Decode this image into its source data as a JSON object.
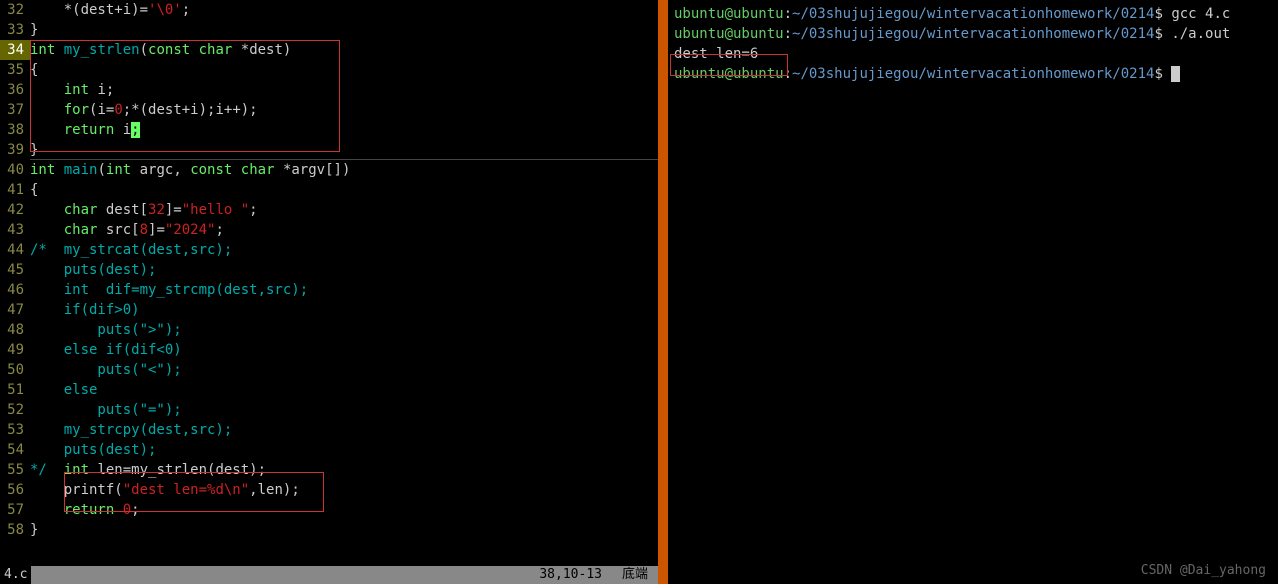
{
  "editor": {
    "lines": [
      {
        "num": "32",
        "tokens": [
          {
            "t": "    ",
            "c": ""
          },
          {
            "t": "*(dest+i)=",
            "c": "op"
          },
          {
            "t": "'\\0'",
            "c": "str"
          },
          {
            "t": ";",
            "c": "op"
          }
        ]
      },
      {
        "num": "33",
        "tokens": [
          {
            "t": "}",
            "c": "op"
          }
        ]
      },
      {
        "num": "34",
        "current": true,
        "tokens": [
          {
            "t": "int",
            "c": "type"
          },
          {
            "t": " ",
            "c": ""
          },
          {
            "t": "my_strlen",
            "c": "func"
          },
          {
            "t": "(",
            "c": "op"
          },
          {
            "t": "const",
            "c": "type"
          },
          {
            "t": " ",
            "c": ""
          },
          {
            "t": "char",
            "c": "type"
          },
          {
            "t": " *dest)",
            "c": "op"
          }
        ]
      },
      {
        "num": "35",
        "tokens": [
          {
            "t": "{",
            "c": "op"
          }
        ]
      },
      {
        "num": "36",
        "tokens": [
          {
            "t": "    ",
            "c": ""
          },
          {
            "t": "int",
            "c": "type"
          },
          {
            "t": " i;",
            "c": "op"
          }
        ]
      },
      {
        "num": "37",
        "tokens": [
          {
            "t": "    ",
            "c": ""
          },
          {
            "t": "for",
            "c": "kw"
          },
          {
            "t": "(i=",
            "c": "op"
          },
          {
            "t": "0",
            "c": "num"
          },
          {
            "t": ";*(dest+i);i++);",
            "c": "op"
          }
        ]
      },
      {
        "num": "38",
        "tokens": [
          {
            "t": "    ",
            "c": ""
          },
          {
            "t": "return",
            "c": "kw"
          },
          {
            "t": " i",
            "c": "op"
          },
          {
            "t": ";",
            "c": "cursor-block"
          }
        ]
      },
      {
        "num": "39",
        "tokens": [
          {
            "t": "}",
            "c": "op"
          }
        ]
      },
      {
        "num": "40",
        "tokens": [
          {
            "t": "int",
            "c": "type"
          },
          {
            "t": " ",
            "c": ""
          },
          {
            "t": "main",
            "c": "func"
          },
          {
            "t": "(",
            "c": "op"
          },
          {
            "t": "int",
            "c": "type"
          },
          {
            "t": " argc, ",
            "c": "op"
          },
          {
            "t": "const",
            "c": "type"
          },
          {
            "t": " ",
            "c": ""
          },
          {
            "t": "char",
            "c": "type"
          },
          {
            "t": " *argv[])",
            "c": "op"
          }
        ]
      },
      {
        "num": "41",
        "tokens": [
          {
            "t": "{",
            "c": "op"
          }
        ]
      },
      {
        "num": "42",
        "tokens": [
          {
            "t": "    ",
            "c": ""
          },
          {
            "t": "char",
            "c": "type"
          },
          {
            "t": " dest[",
            "c": "op"
          },
          {
            "t": "32",
            "c": "num"
          },
          {
            "t": "]=",
            "c": "op"
          },
          {
            "t": "\"hello \"",
            "c": "str"
          },
          {
            "t": ";",
            "c": "op"
          }
        ]
      },
      {
        "num": "43",
        "tokens": [
          {
            "t": "    ",
            "c": ""
          },
          {
            "t": "char",
            "c": "type"
          },
          {
            "t": " src[",
            "c": "op"
          },
          {
            "t": "8",
            "c": "num"
          },
          {
            "t": "]=",
            "c": "op"
          },
          {
            "t": "\"2024\"",
            "c": "str"
          },
          {
            "t": ";",
            "c": "op"
          }
        ]
      },
      {
        "num": "44",
        "tokens": [
          {
            "t": "/*  my_strcat(dest,src);",
            "c": "comment"
          }
        ]
      },
      {
        "num": "45",
        "tokens": [
          {
            "t": "    puts(dest);",
            "c": "comment"
          }
        ]
      },
      {
        "num": "46",
        "tokens": [
          {
            "t": "    int  dif=my_strcmp(dest,src);",
            "c": "comment"
          }
        ]
      },
      {
        "num": "47",
        "tokens": [
          {
            "t": "    if(dif>0)",
            "c": "comment"
          }
        ]
      },
      {
        "num": "48",
        "tokens": [
          {
            "t": "        puts(\">\");",
            "c": "comment"
          }
        ]
      },
      {
        "num": "49",
        "tokens": [
          {
            "t": "    else if(dif<0)",
            "c": "comment"
          }
        ]
      },
      {
        "num": "50",
        "tokens": [
          {
            "t": "        puts(\"<\");",
            "c": "comment"
          }
        ]
      },
      {
        "num": "51",
        "tokens": [
          {
            "t": "    else",
            "c": "comment"
          }
        ]
      },
      {
        "num": "52",
        "tokens": [
          {
            "t": "        puts(\"=\");",
            "c": "comment"
          }
        ]
      },
      {
        "num": "53",
        "tokens": [
          {
            "t": "    my_strcpy(dest,src);",
            "c": "comment"
          }
        ]
      },
      {
        "num": "54",
        "tokens": [
          {
            "t": "    puts(dest);",
            "c": "comment"
          }
        ]
      },
      {
        "num": "55",
        "tokens": [
          {
            "t": "*/",
            "c": "comment"
          },
          {
            "t": "  ",
            "c": ""
          },
          {
            "t": "int",
            "c": "type"
          },
          {
            "t": " len=my_strlen(dest);",
            "c": "op"
          }
        ]
      },
      {
        "num": "56",
        "tokens": [
          {
            "t": "    printf(",
            "c": "op"
          },
          {
            "t": "\"dest len=",
            "c": "str"
          },
          {
            "t": "%d\\n",
            "c": "esc"
          },
          {
            "t": "\"",
            "c": "str"
          },
          {
            "t": ",len);",
            "c": "op"
          }
        ]
      },
      {
        "num": "57",
        "tokens": [
          {
            "t": "    ",
            "c": ""
          },
          {
            "t": "return",
            "c": "kw"
          },
          {
            "t": " ",
            "c": ""
          },
          {
            "t": "0",
            "c": "num"
          },
          {
            "t": ";",
            "c": "op"
          }
        ]
      },
      {
        "num": "58",
        "tokens": [
          {
            "t": "}",
            "c": "op"
          }
        ]
      }
    ],
    "status": {
      "file": "4.c",
      "pos": "38,10-13",
      "scroll": "底端"
    }
  },
  "terminal": {
    "lines": [
      {
        "prompt_user": "ubuntu@ubuntu",
        "prompt_path": "~/03shujujiegou/wintervacationhomework/0214",
        "cmd": "gcc 4.c"
      },
      {
        "prompt_user": "ubuntu@ubuntu",
        "prompt_path": "~/03shujujiegou/wintervacationhomework/0214",
        "cmd": "./a.out"
      },
      {
        "output": "dest len=6"
      },
      {
        "prompt_user": "ubuntu@ubuntu",
        "prompt_path": "~/03shujujiegou/wintervacationhomework/0214",
        "cmd": "",
        "cursor": true
      }
    ]
  },
  "watermark": "CSDN @Dai_yahong"
}
